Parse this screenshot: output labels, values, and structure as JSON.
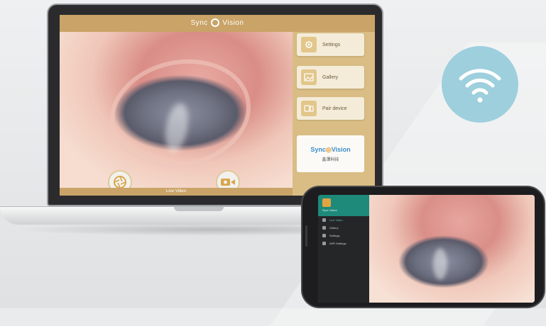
{
  "laptop_app": {
    "title_left": "Sync",
    "title_right": "Vision",
    "status_text": "Live Video",
    "buttons": [
      {
        "label": "Settings",
        "icon": "settings-icon"
      },
      {
        "label": "Gallery",
        "icon": "gallery-icon"
      },
      {
        "label": "Pair device",
        "icon": "pair-device-icon"
      }
    ],
    "logo_card": {
      "brand_left": "Sync",
      "brand_right": "Vision",
      "subtitle": "鑫澤科技"
    },
    "controls": {
      "shutter_icon": "shutter-icon",
      "record_icon": "video-record-icon"
    }
  },
  "wifi": {
    "icon": "wifi-icon",
    "color": "#9ecfdd"
  },
  "phone_app": {
    "drawer_header_name": "Sync Vision",
    "menu": [
      {
        "label": "Live Video",
        "active": true
      },
      {
        "label": "Gallery",
        "active": false
      },
      {
        "label": "Settings",
        "active": false
      },
      {
        "label": "WiFi Settings",
        "active": false
      }
    ],
    "accent": "#1d8a7a"
  },
  "colors": {
    "app_bar": "#c9a367",
    "panel": "#d9bd84"
  }
}
